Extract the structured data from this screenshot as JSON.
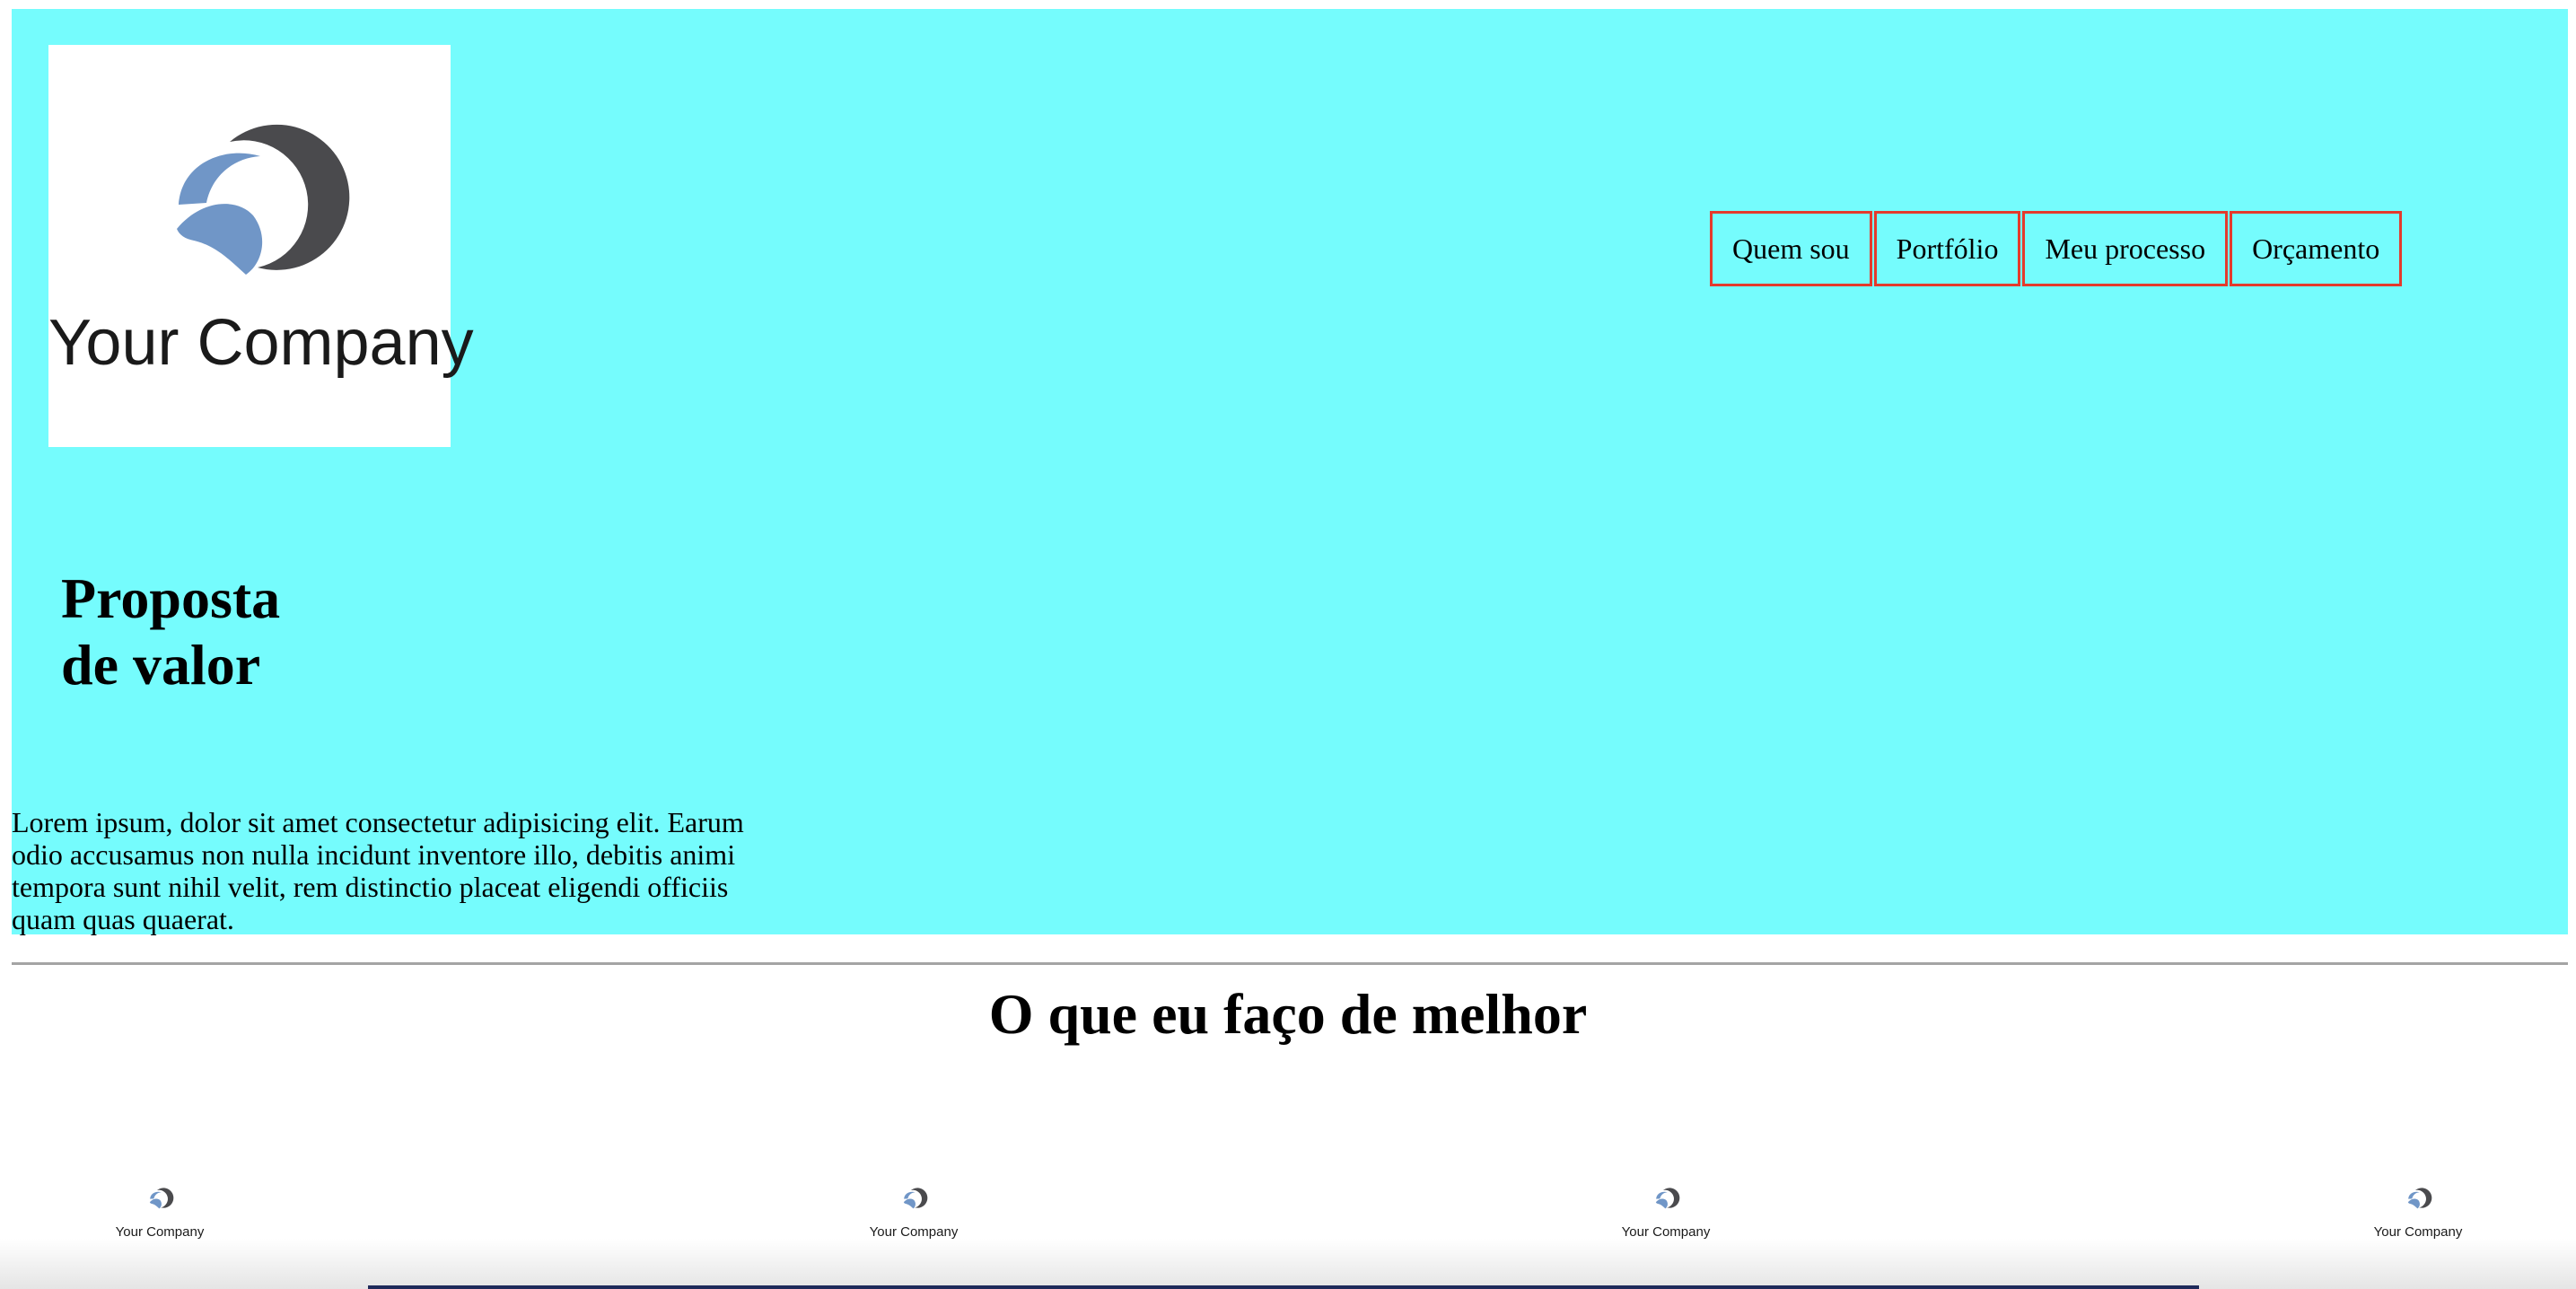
{
  "header": {
    "logo": {
      "icon": "company-logo-icon",
      "text": "Your Company"
    },
    "nav": {
      "items": [
        {
          "label": "Quem sou"
        },
        {
          "label": "Portfólio"
        },
        {
          "label": "Meu processo"
        },
        {
          "label": "Orçamento"
        }
      ],
      "border_color": "#e43a2c"
    },
    "background_color": "#75fcfd"
  },
  "hero": {
    "title_line1": "Proposta",
    "title_line2": "de valor",
    "paragraph": "Lorem ipsum, dolor sit amet consectetur adipisicing elit. Earum odio accusamus non nulla incidunt inventore illo, debitis animi tempora sunt nihil velit, rem distinctio placeat eligendi officiis quam quas quaerat."
  },
  "services": {
    "title": "O que eu faço de melhor",
    "logos": [
      {
        "icon": "company-logo-icon",
        "text": "Your Company"
      },
      {
        "icon": "company-logo-icon",
        "text": "Your Company"
      },
      {
        "icon": "company-logo-icon",
        "text": "Your Company"
      },
      {
        "icon": "company-logo-icon",
        "text": "Your Company"
      }
    ]
  }
}
